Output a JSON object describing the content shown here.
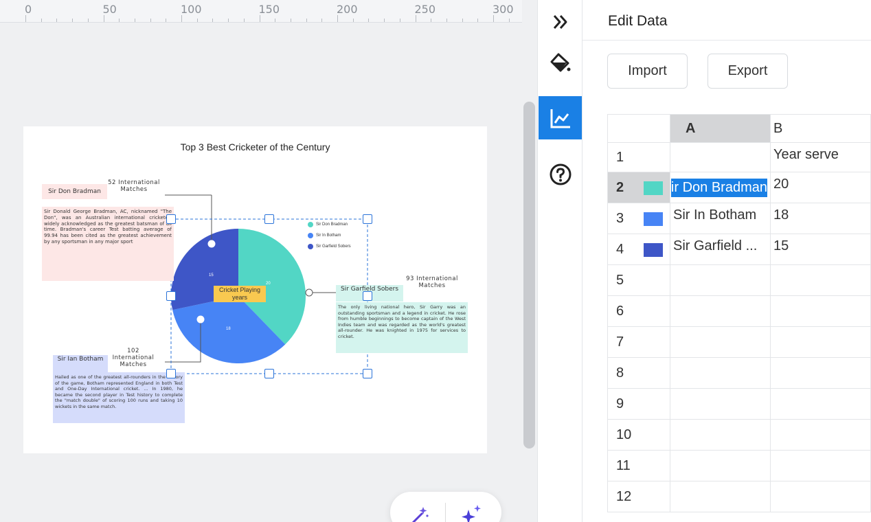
{
  "ruler": {
    "labels": [
      "0",
      "50",
      "100",
      "150",
      "200",
      "250",
      "300"
    ]
  },
  "page": {
    "title": "Top 3 Best Cricketer of the Century",
    "center_label": "Cricket Playing years",
    "legend": [
      {
        "label": "Sir Don Bradman",
        "color": "#52d6c5"
      },
      {
        "label": "Sir In Botham",
        "color": "#4784f5"
      },
      {
        "label": "Sir Garfield Sobers",
        "color": "#3e56c7"
      }
    ],
    "slice_labels": {
      "bradman": "20",
      "botham": "18",
      "sobers": "15"
    },
    "callouts": {
      "bradman": {
        "title": "Sir Don Bradman",
        "count": "52 International Matches",
        "body": "Sir Donald George Bradman, AC, nicknamed \"The Don\", was an Australian international cricketer, widely acknowledged as the greatest batsman of all time. Bradman's career Test batting average of 99.94 has been cited as the greatest achievement by any sportsman in any major sport"
      },
      "sobers": {
        "title": "Sir Garfield Sobers",
        "count": "93 International Matches",
        "body": "The only living national hero, Sir Garry was an outstanding sportsman and a legend in cricket. He rose from humble beginnings to become captain of the West Indies team and was regarded as the world's greatest all-rounder. He was knighted in 1975 for services to cricket."
      },
      "botham": {
        "title": "Sir Ian Botham",
        "count": "102 International Matches",
        "body": "Hailed as one of the greatest all-rounders in the history of the game, Botham represented England in both Test and One-Day International cricket. ... In 1980, he became the second player in Test history to complete the \"match double\" of scoring 100 runs and taking 10 wickets in the same match."
      }
    }
  },
  "chart_data": {
    "type": "pie",
    "title": "Top 3 Best Cricketer of the Century",
    "categories": [
      "Sir Don Bradman",
      "Sir In Botham",
      "Sir Garfield Sobers"
    ],
    "values": [
      20,
      18,
      15
    ],
    "colors": [
      "#52d6c5",
      "#4784f5",
      "#3e56c7"
    ],
    "legend_position": "top-right"
  },
  "sidebar": {
    "icons": [
      "expand-icon",
      "paint-bucket-icon",
      "chart-icon",
      "help-icon"
    ]
  },
  "panel": {
    "title": "Edit Data",
    "import_label": "Import",
    "export_label": "Export",
    "columns": [
      "A",
      "B"
    ],
    "rows": [
      {
        "num": "1",
        "a": "",
        "b": "Year serve",
        "color": ""
      },
      {
        "num": "2",
        "a": "Sir Don Bradman",
        "b": "20",
        "color": "#52d6c5"
      },
      {
        "num": "3",
        "a": "Sir In Botham",
        "b": "18",
        "color": "#4784f5"
      },
      {
        "num": "4",
        "a": "Sir Garfield ...",
        "b": "15",
        "color": "#3e56c7"
      },
      {
        "num": "5",
        "a": "",
        "b": "",
        "color": ""
      },
      {
        "num": "6",
        "a": "",
        "b": "",
        "color": ""
      },
      {
        "num": "7",
        "a": "",
        "b": "",
        "color": ""
      },
      {
        "num": "8",
        "a": "",
        "b": "",
        "color": ""
      },
      {
        "num": "9",
        "a": "",
        "b": "",
        "color": ""
      },
      {
        "num": "10",
        "a": "",
        "b": "",
        "color": ""
      },
      {
        "num": "11",
        "a": "",
        "b": "",
        "color": ""
      },
      {
        "num": "12",
        "a": "",
        "b": "",
        "color": ""
      }
    ]
  }
}
